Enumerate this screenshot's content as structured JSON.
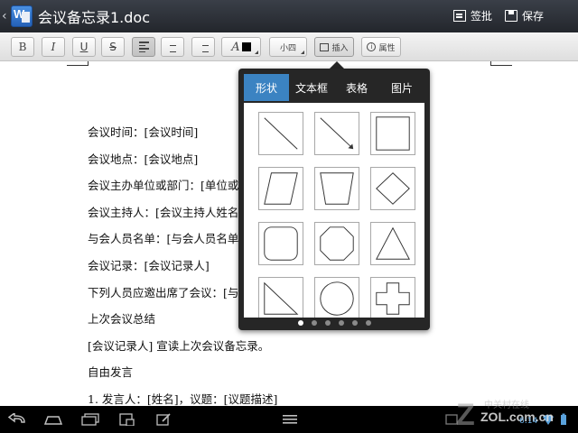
{
  "titlebar": {
    "document_title": "会议备忘录1.doc",
    "review_label": "签批",
    "save_label": "保存"
  },
  "toolbar": {
    "bold": "B",
    "italic": "I",
    "underline": "U",
    "strikethrough": "S",
    "font_color": "A",
    "font_size": "小四",
    "insert": "插入",
    "properties": "属性"
  },
  "document": {
    "lines": [
      "会议时间：[会议时间]",
      "会议地点：[会议地点]",
      "会议主办单位或部门：[单位或",
      "会议主持人：[会议主持人姓名",
      "与会人员名单：[与会人员名单",
      "会议记录：[会议记录人]",
      "下列人员应邀出席了会议：[与",
      "上次会议总结",
      "[会议记录人] 宣读上次会议备忘录。",
      "自由发言",
      "1.   发言人：[姓名]，议题：[议题描述]"
    ]
  },
  "insert_popup": {
    "tabs": [
      "形状",
      "文本框",
      "表格",
      "图片"
    ],
    "active_tab": 0,
    "shapes": [
      "line",
      "arrow-line",
      "rectangle",
      "parallelogram",
      "trapezoid",
      "diamond",
      "rounded-rectangle",
      "octagon",
      "triangle",
      "right-triangle",
      "circle",
      "cross"
    ],
    "page_count": 6,
    "current_page": 0
  },
  "status": {
    "time": "6:14"
  },
  "watermark": {
    "text": "中关村在线",
    "domain": "ZOL.com.cn"
  },
  "colors": {
    "active_tab": "#3b83c2",
    "title_bar": "#2b2f36",
    "popup_bg": "#262626"
  }
}
